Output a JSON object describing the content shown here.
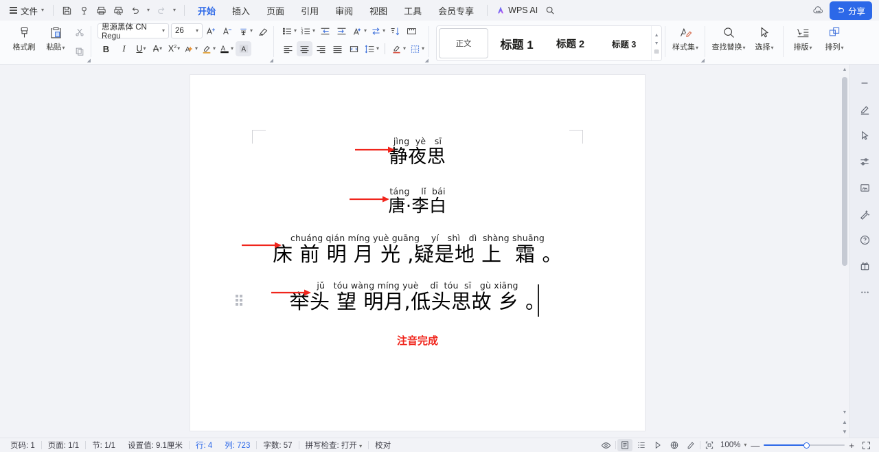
{
  "menubar": {
    "file_label": "文件",
    "quick_icons": [
      "save-icon",
      "search-doc-icon",
      "print-icon",
      "print-preview-icon",
      "undo-icon",
      "redo-icon",
      "customize-icon"
    ],
    "tabs": [
      {
        "label": "开始",
        "active": true
      },
      {
        "label": "插入",
        "active": false
      },
      {
        "label": "页面",
        "active": false
      },
      {
        "label": "引用",
        "active": false
      },
      {
        "label": "审阅",
        "active": false
      },
      {
        "label": "视图",
        "active": false
      },
      {
        "label": "工具",
        "active": false
      },
      {
        "label": "会员专享",
        "active": false
      }
    ],
    "wps_ai_label": "WPS AI",
    "search_icon": "search-icon",
    "cloud_icon": "cloud-icon",
    "share_label": "分享"
  },
  "ribbon": {
    "format_painter_label": "格式刷",
    "paste_label": "粘贴",
    "cut_icon": "scissors-icon",
    "copy_icon": "copy-icon",
    "font_name": "思源黑体 CN Regu",
    "font_size": "26",
    "bold_label": "B",
    "italic_label": "I",
    "underline_label": "U",
    "strikethrough_label": "A",
    "superscript_label": "X",
    "superscript_sup": "2",
    "text_effect_label": "A",
    "grow_font_icon": "grow-font-icon",
    "shrink_font_icon": "shrink-font-icon",
    "pinyin_guide_icon": "pinyin-guide-icon",
    "clear_format_icon": "clear-format-icon",
    "highlight_icon": "highlight-icon",
    "font_color_icon": "font-color-icon",
    "char_shading_icon": "char-shading-icon",
    "bullets_icon": "bullet-list-icon",
    "numbering_icon": "numbered-list-icon",
    "decrease_indent_icon": "decrease-indent-icon",
    "increase_indent_icon": "increase-indent-icon",
    "pinyin_tool_icon": "asian-layout-icon",
    "ltr_rtl_icon": "text-direction-icon",
    "sort_icon": "sort-icon",
    "show_marks_icon": "show-formatting-marks-icon",
    "align_left_icon": "align-left-icon",
    "align_center_icon": "align-center-icon",
    "align_right_icon": "align-right-icon",
    "align_justify_icon": "align-justify-icon",
    "distribute_icon": "distribute-text-icon",
    "line_spacing_icon": "line-spacing-icon",
    "shading_icon": "paragraph-shading-icon",
    "borders_icon": "borders-icon",
    "styles": [
      {
        "label": "正文",
        "selected": true
      },
      {
        "label": "标题 1",
        "selected": false
      },
      {
        "label": "标题 2",
        "selected": false
      },
      {
        "label": "标题 3",
        "selected": false
      }
    ],
    "style_set_label": "样式集",
    "find_replace_label": "查找替换",
    "select_label": "选择",
    "typeset_label": "排版",
    "arrange_label": "排列"
  },
  "document": {
    "lines": [
      {
        "pinyin": "jìng  yè   sī",
        "hanzi": "静夜思",
        "kind": "title"
      },
      {
        "pinyin": "táng    lǐ  bái",
        "hanzi": "唐·李白",
        "kind": "author"
      },
      {
        "pinyin": "chuáng qián míng yuè guāng    yí   shì   dì  shàng shuāng",
        "hanzi": "床 前 明 月 光 ,疑是地 上  霜 。",
        "kind": "verse"
      },
      {
        "pinyin": "jǔ   tóu wàng míng yuè    dī  tóu  sī   gù xiāng",
        "hanzi": "举头 望 明月,低头思故 乡 。",
        "kind": "verse"
      }
    ],
    "note": "注音完成",
    "note_color": "#f0251c"
  },
  "right_sidebar": {
    "items": [
      {
        "icon": "collapse-panel-icon",
        "name": "collapse"
      },
      {
        "icon": "pen-edit-icon",
        "name": "edit"
      },
      {
        "icon": "cursor-select-icon",
        "name": "select"
      },
      {
        "icon": "settings-sliders-icon",
        "name": "settings"
      },
      {
        "icon": "signature-icon",
        "name": "signature"
      },
      {
        "icon": "magic-wand-icon",
        "name": "beautify"
      },
      {
        "icon": "help-circle-icon",
        "name": "help"
      },
      {
        "icon": "gift-icon",
        "name": "gift"
      },
      {
        "icon": "more-dots-icon",
        "name": "more"
      }
    ]
  },
  "statusbar": {
    "page_no": "页码: 1",
    "page_of": "页面: 1/1",
    "section": "节: 1/1",
    "setting_value": "设置值: 9.1厘米",
    "row": "行: 4",
    "col": "列: 723",
    "word_count": "字数: 57",
    "spell_check": "拼写检查: 打开",
    "proofread": "校对",
    "view_icons": [
      "eye-preview-icon",
      "page-view-icon",
      "outline-view-icon",
      "web-view-icon",
      "read-mode-icon",
      "pen-mode-icon",
      "fit-page-icon"
    ],
    "zoom_label": "100%",
    "zoom_out": "—",
    "zoom_in": "+",
    "fullscreen_icon": "fullscreen-icon"
  }
}
